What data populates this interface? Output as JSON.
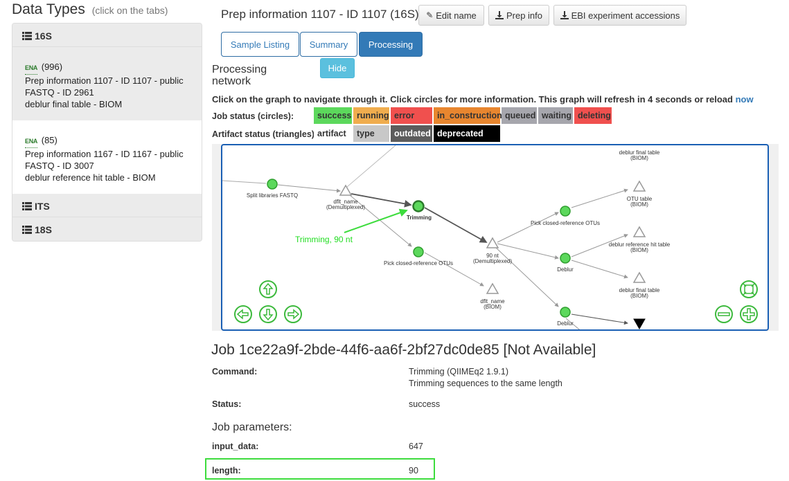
{
  "sidebar": {
    "title": "Data Types",
    "hint": "(click on the tabs)",
    "groups": [
      {
        "label": "16S"
      },
      {
        "label": "ITS"
      },
      {
        "label": "18S"
      }
    ],
    "preps": [
      {
        "ena": "ENA",
        "count": "(996)",
        "line1": "Prep information 1107 - ID 1107 - public",
        "line2": "FASTQ - ID 2961",
        "line3": "deblur final table - BIOM"
      },
      {
        "ena": "ENA",
        "count": "(85)",
        "line1": "Prep information 1167 - ID 1167 - public",
        "line2": "FASTQ - ID 3007",
        "line3": "deblur reference hit table - BIOM"
      }
    ]
  },
  "header": {
    "title": "Prep information 1107 - ID 1107 (16S)",
    "edit_name": "Edit name",
    "prep_info": "Prep info",
    "ebi": "EBI experiment accessions"
  },
  "tabs": [
    {
      "label": "Sample Listing",
      "active": false
    },
    {
      "label": "Summary",
      "active": false
    },
    {
      "label": "Processing",
      "active": true
    }
  ],
  "processing": {
    "title": "Processing network",
    "hide": "Hide",
    "info_text": "Click on the graph to navigate through it. Click circles for more information. This graph will refresh in 4 seconds or reload",
    "info_link": "now",
    "job_status_label": "Job status (circles):",
    "job_statuses": [
      {
        "label": "success",
        "color": "#5cd85c"
      },
      {
        "label": "running",
        "color": "#f0ad4e"
      },
      {
        "label": "error",
        "color": "#f0504e"
      },
      {
        "label": "in_construction",
        "color": "#e8862f"
      },
      {
        "label": "queued",
        "color": "#a6a6ad"
      },
      {
        "label": "waiting",
        "color": "#a6a6ad"
      },
      {
        "label": "deleting",
        "color": "#f0504e"
      }
    ],
    "artifact_status_label": "Artifact status (triangles):",
    "artifact_statuses": [
      {
        "label": "artifact",
        "color": "#ffffff"
      },
      {
        "label": "type",
        "color": "#c8c8c8"
      },
      {
        "label": "outdated",
        "color": "#5c5c5c"
      },
      {
        "label": "deprecated",
        "color": "#000000"
      }
    ]
  },
  "graph": {
    "nodes": {
      "split": "Split libraries FASTQ",
      "dflt1_a": "dflt_name",
      "dflt1_b": "(Demultiplexed)",
      "trimming": "Trimming",
      "pick1": "Pick closed-reference OTUs",
      "nt90_a": "90 nt",
      "nt90_b": "(Demultiplexed)",
      "dflt2_a": "dflt_name",
      "dflt2_b": "(BIOM)",
      "pick2": "Pick closed-reference OTUs",
      "deblur1": "Deblur",
      "deblur2": "Deblur",
      "final_top_a": "deblur final table",
      "final_top_b": "(BIOM)",
      "otu_a": "OTU table",
      "otu_b": "(BIOM)",
      "ref_a": "deblur reference hit table",
      "ref_b": "(BIOM)",
      "final2_a": "deblur final table",
      "final2_b": "(BIOM)"
    },
    "annotation": "Trimming, 90 nt"
  },
  "job": {
    "title": "Job 1ce22a9f-2bde-44f6-aa6f-2bf27dc0de85 [Not Available]",
    "command_label": "Command:",
    "command_value": "Trimming (QIIMEq2 1.9.1)",
    "command_desc": "Trimming sequences to the same length",
    "status_label": "Status:",
    "status_value": "success",
    "params_title": "Job parameters:",
    "params": [
      {
        "key": "input_data:",
        "value": "647"
      },
      {
        "key": "length:",
        "value": "90"
      }
    ]
  }
}
